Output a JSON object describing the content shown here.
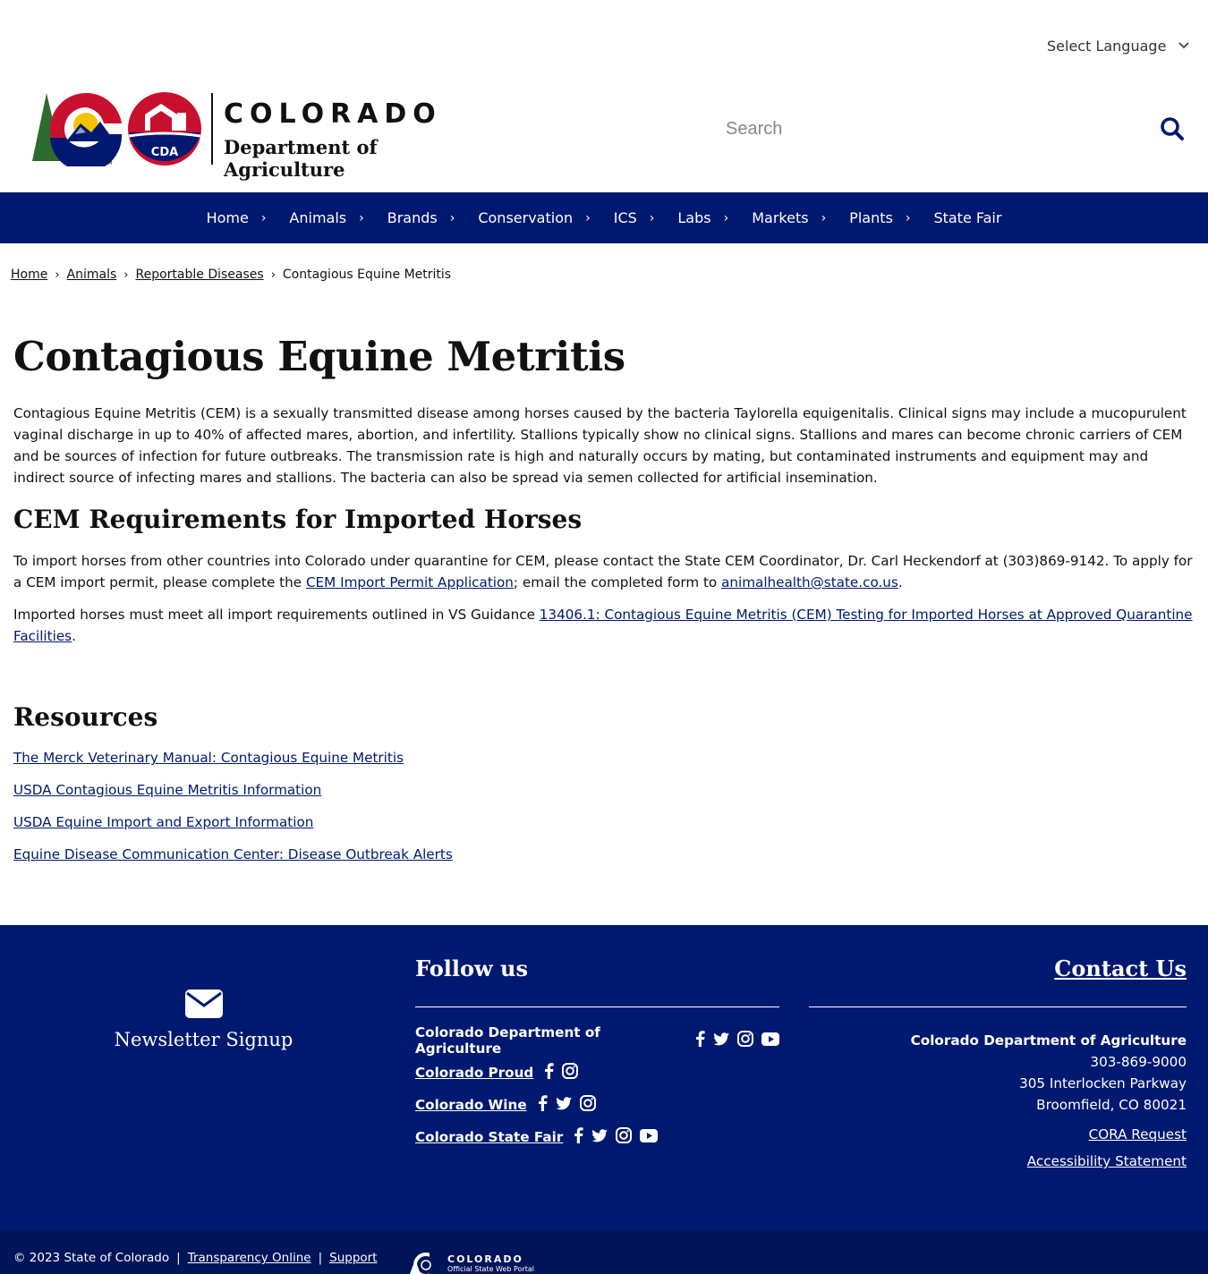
{
  "language": {
    "label": "Select Language"
  },
  "brand": {
    "name_line1": "COLORADO",
    "name_line2": "Department of Agriculture",
    "cda_badge": "CDA",
    "colors": {
      "navy": "#001970",
      "red": "#c8102e",
      "gold": "#f2c300",
      "green": "#2e6b2e"
    }
  },
  "search": {
    "placeholder": "Search"
  },
  "nav": {
    "items": [
      {
        "label": "Home"
      },
      {
        "label": "Animals"
      },
      {
        "label": "Brands"
      },
      {
        "label": "Conservation"
      },
      {
        "label": "ICS"
      },
      {
        "label": "Labs"
      },
      {
        "label": "Markets"
      },
      {
        "label": "Plants"
      },
      {
        "label": "State Fair"
      }
    ]
  },
  "breadcrumb": {
    "items": [
      "Home",
      "Animals",
      "Reportable Diseases"
    ],
    "current": "Contagious Equine Metritis"
  },
  "page": {
    "title": "Contagious Equine Metritis",
    "intro": "Contagious Equine Metritis (CEM) is a sexually transmitted disease among horses caused by the bacteria Taylorella equigenitalis. Clinical signs may include a mucopurulent vaginal discharge in up to 40% of affected mares, abortion, and infertility. Stallions typically show no clinical signs. Stallions and mares can become chronic carriers of CEM and be sources of infection for future outbreaks. The transmission rate is high and naturally occurs by mating, but contaminated instruments and equipment may and indirect source of infecting mares and stallions. The bacteria can also be spread via semen collected for artificial insemination.",
    "req_heading": "CEM Requirements for Imported Horses",
    "req_p1_a": "To import horses from other countries into Colorado under quarantine for CEM, please contact the State CEM Coordinator, Dr. Carl Heckendorf at (303)869-9142. To apply for a CEM import permit, please complete the ",
    "req_p1_link": "CEM Import Permit Application",
    "req_p1_b": "; email the completed form to ",
    "req_p1_email": "animalhealth@state.co.us",
    "req_p1_c": ".",
    "req_p2_a": "Imported horses must meet all import requirements outlined in VS Guidance ",
    "req_p2_link": "13406.1: Contagious Equine Metritis (CEM) Testing for Imported Horses at Approved Quarantine Facilities",
    "req_p2_b": ".",
    "resources_heading": "Resources",
    "resources": [
      "The Merck Veterinary Manual: Contagious Equine Metritis",
      "USDA Contagious Equine Metritis Information",
      "USDA Equine Import and Export Information",
      "Equine Disease Communication Center: Disease Outbreak Alerts"
    ]
  },
  "footer": {
    "newsletter": "Newsletter Signup",
    "follow_heading": "Follow us",
    "follow_rows": [
      {
        "label": "Colorado Department of Agriculture",
        "icons": [
          "facebook-icon",
          "twitter-icon",
          "instagram-icon",
          "youtube-icon"
        ]
      },
      {
        "label": "Colorado Proud",
        "icons": [
          "facebook-icon",
          "instagram-icon"
        ]
      },
      {
        "label": "Colorado Wine",
        "icons": [
          "facebook-icon",
          "twitter-icon",
          "instagram-icon"
        ]
      },
      {
        "label": "Colorado State Fair",
        "icons": [
          "facebook-icon",
          "twitter-icon",
          "instagram-icon",
          "youtube-icon"
        ]
      }
    ],
    "contact_heading": "Contact Us",
    "contact_org": "Colorado Department of Agriculture",
    "contact_phone": "303-869-9000",
    "contact_street": "305 Interlocken Parkway",
    "contact_city": "Broomfield, CO 80021",
    "cora": "CORA Request",
    "accessibility": "Accessibility Statement",
    "copyright": "© 2023 State of Colorado",
    "sep": "|",
    "transparency": "Transparency Online",
    "support": "Support",
    "portal_line1": "COLORADO",
    "portal_line2": "Official State Web Portal"
  }
}
